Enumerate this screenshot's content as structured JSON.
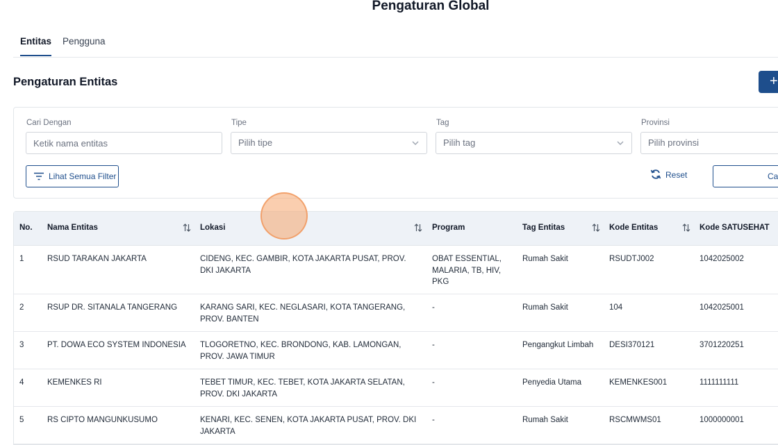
{
  "page_title": "Pengaturan Global",
  "tabs": [
    {
      "label": "Entitas",
      "active": true
    },
    {
      "label": "Pengguna",
      "active": false
    }
  ],
  "section_title": "Pengaturan Entitas",
  "add_button": {
    "label": "+"
  },
  "filters": {
    "cari": {
      "label": "Cari Dengan",
      "placeholder": "Ketik nama entitas"
    },
    "tipe": {
      "label": "Tipe",
      "placeholder": "Pilih tipe"
    },
    "tag": {
      "label": "Tag",
      "placeholder": "Pilih tag"
    },
    "provinsi": {
      "label": "Provinsi",
      "placeholder": "Pilih provinsi"
    },
    "all_filters_label": "Lihat Semua Filter",
    "reset_label": "Reset",
    "search_label": "Ca"
  },
  "table": {
    "headers": [
      "No.",
      "Nama Entitas",
      "Lokasi",
      "Program",
      "Tag Entitas",
      "Kode Entitas",
      "Kode SATUSEHAT"
    ],
    "rows": [
      {
        "no": "1",
        "nama": "RSUD TARAKAN JAKARTA",
        "lokasi": "CIDENG, KEC. GAMBIR, KOTA JAKARTA PUSAT, PROV. DKI JAKARTA",
        "program": "OBAT ESSENTIAL, MALARIA, TB, HIV, PKG",
        "tag": "Rumah Sakit",
        "kode": "RSUDTJ002",
        "satusehat": "1042025002"
      },
      {
        "no": "2",
        "nama": "RSUP DR. SITANALA TANGERANG",
        "lokasi": "KARANG SARI, KEC. NEGLASARI, KOTA TANGERANG, PROV. BANTEN",
        "program": "-",
        "tag": "Rumah Sakit",
        "kode": "104",
        "satusehat": "1042025001"
      },
      {
        "no": "3",
        "nama": "PT. DOWA ECO SYSTEM INDONESIA",
        "lokasi": "TLOGORETNO, KEC. BRONDONG, KAB. LAMONGAN, PROV. JAWA TIMUR",
        "program": "-",
        "tag": "Pengangkut Limbah",
        "kode": "DESI370121",
        "satusehat": "3701220251"
      },
      {
        "no": "4",
        "nama": "KEMENKES RI",
        "lokasi": "TEBET TIMUR, KEC. TEBET, KOTA JAKARTA SELATAN, PROV. DKI JAKARTA",
        "program": "-",
        "tag": "Penyedia Utama",
        "kode": "KEMENKES001",
        "satusehat": "1111111111"
      },
      {
        "no": "5",
        "nama": "RS CIPTO MANGUNKUSUMO",
        "lokasi": "KENARI, KEC. SENEN, KOTA JAKARTA PUSAT, PROV. DKI JAKARTA",
        "program": "-",
        "tag": "Rumah Sakit",
        "kode": "RSCMWMS01",
        "satusehat": "1000000001"
      }
    ]
  },
  "colors": {
    "primary": "#1e4e8c",
    "header_bg": "#eef2f7"
  }
}
